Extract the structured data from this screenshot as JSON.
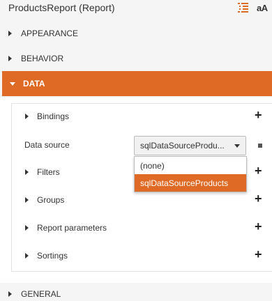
{
  "header": {
    "title": "ProductsReport (Report)",
    "sort_icon": "sort-list-icon",
    "font_toggle_label": "aA"
  },
  "groups": {
    "appearance": "APPEARANCE",
    "behavior": "BEHAVIOR",
    "data": "DATA",
    "general": "GENERAL"
  },
  "data_section": {
    "bindings": "Bindings",
    "data_source_label": "Data source",
    "data_source_value": "sqlDataSourceProdu...",
    "filters": "Filters",
    "groups": "Groups",
    "report_parameters": "Report parameters",
    "sortings": "Sortings",
    "add_symbol": "+"
  },
  "dropdown": {
    "options": [
      "(none)",
      "sqlDataSourceProducts"
    ],
    "selected_index": 1
  },
  "colors": {
    "accent": "#de6a25",
    "background": "#f5f5f5"
  }
}
